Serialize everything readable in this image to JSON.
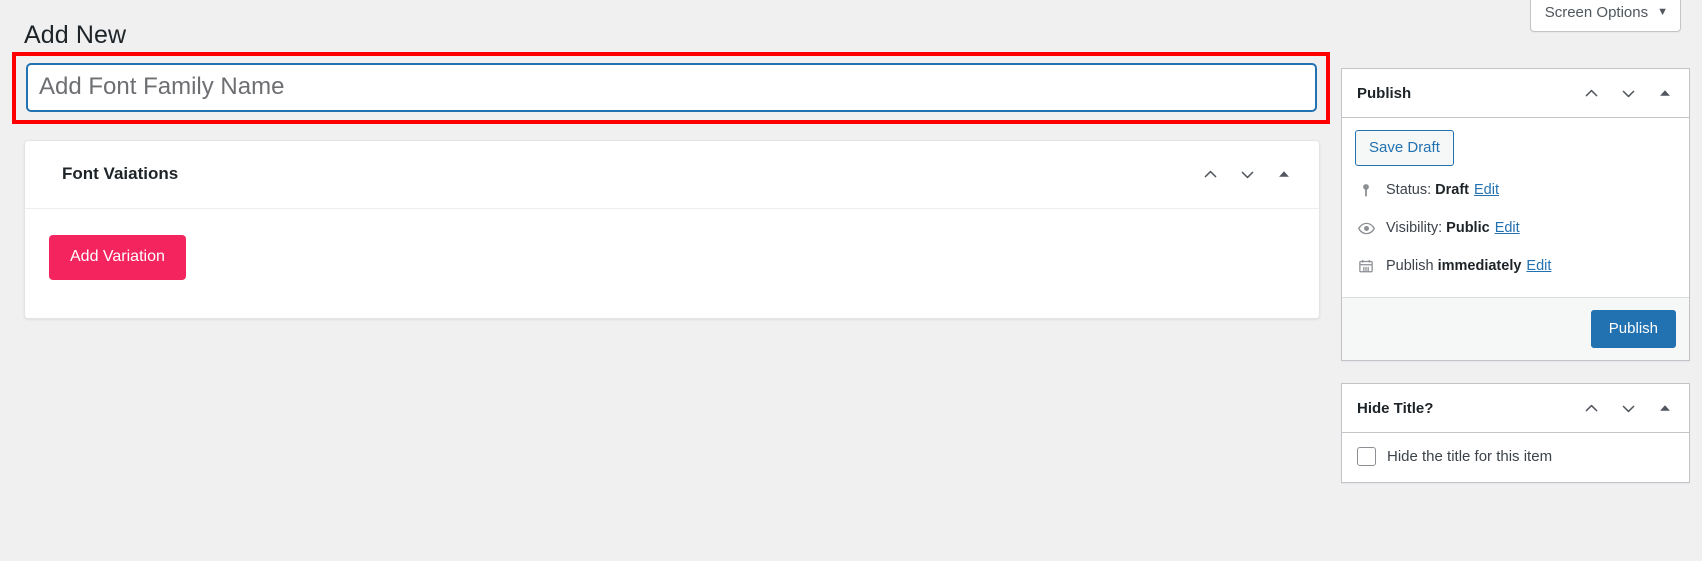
{
  "screen_options": {
    "label": "Screen Options",
    "caret": "▼",
    "icon": "chevron-down-icon"
  },
  "header": {
    "title": "Add New"
  },
  "title_field": {
    "placeholder": "Add Font Family Name",
    "value": "",
    "highlight_color": "#ff0000",
    "focus_color": "#2271b1"
  },
  "variations_panel": {
    "title": "Font Vaiations",
    "add_button": "Add Variation",
    "add_button_color": "#f4245e",
    "actions": [
      {
        "name": "move-up-icon",
        "label": "Move up"
      },
      {
        "name": "move-down-icon",
        "label": "Move down"
      },
      {
        "name": "toggle-panel-icon",
        "label": "Toggle panel"
      }
    ]
  },
  "publish_panel": {
    "title": "Publish",
    "save_draft": "Save Draft",
    "publish_button": "Publish",
    "publish_button_color": "#2271b1",
    "actions": [
      {
        "name": "move-up-icon",
        "label": "Move up"
      },
      {
        "name": "move-down-icon",
        "label": "Move down"
      },
      {
        "name": "toggle-panel-icon",
        "label": "Toggle panel"
      }
    ],
    "status": {
      "icon": "post-status-icon",
      "label": "Status:",
      "value": "Draft",
      "edit": "Edit"
    },
    "visibility": {
      "icon": "eye-icon",
      "label": "Visibility:",
      "value": "Public",
      "edit": "Edit"
    },
    "schedule": {
      "icon": "calendar-icon",
      "label": "Publish",
      "value": "immediately",
      "edit": "Edit"
    }
  },
  "hide_title_panel": {
    "title": "Hide Title?",
    "checkbox_label": "Hide the title for this item",
    "checked": false,
    "actions": [
      {
        "name": "move-up-icon",
        "label": "Move up"
      },
      {
        "name": "move-down-icon",
        "label": "Move down"
      },
      {
        "name": "toggle-panel-icon",
        "label": "Toggle panel"
      }
    ]
  }
}
